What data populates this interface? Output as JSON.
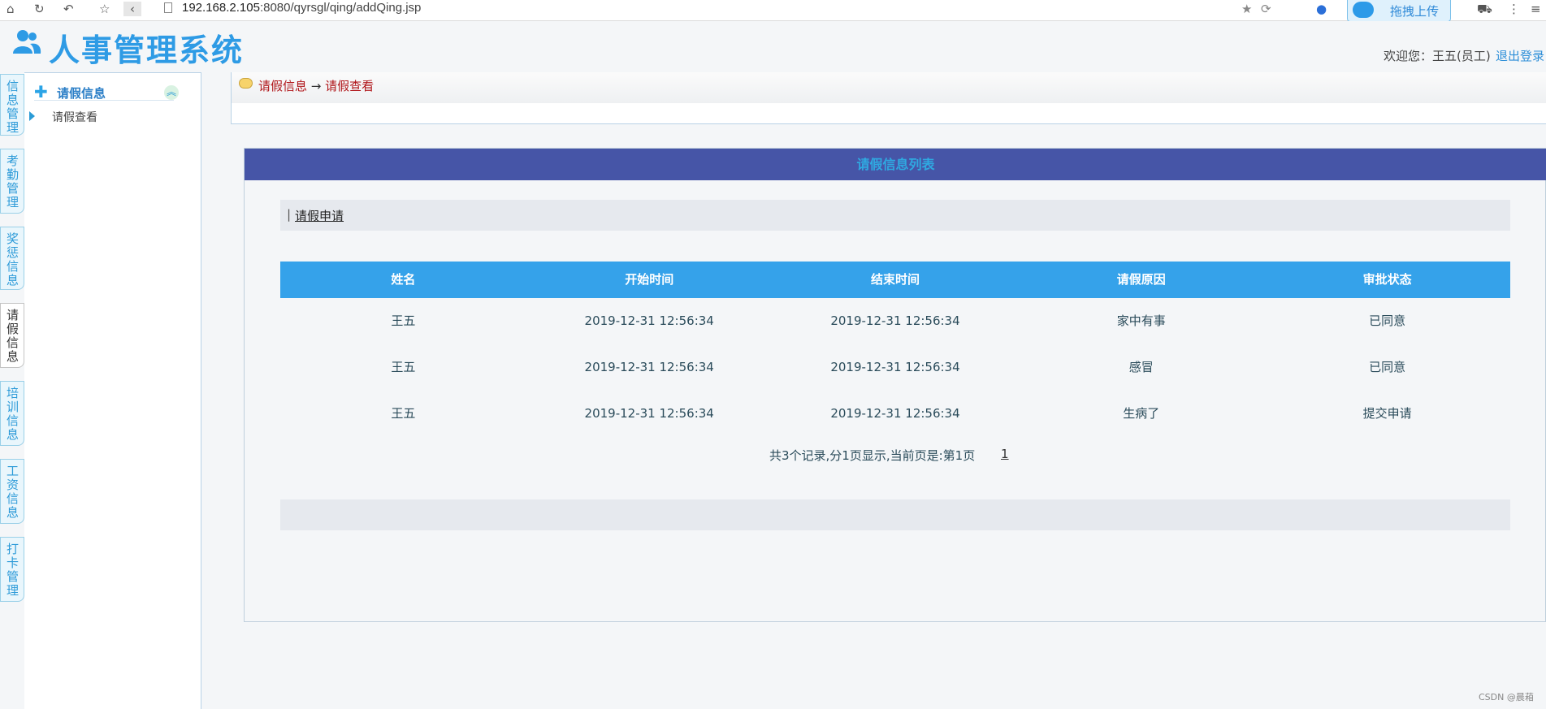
{
  "browser": {
    "url_host": "192.168.2.105",
    "url_rest": ":8080/qyrsgl/qing/addQing.jsp",
    "upload_label": "拖拽上传"
  },
  "header": {
    "app_title": "人事管理系统",
    "welcome": "欢迎您：王五(员工)",
    "logout": "退出登录"
  },
  "tabs": [
    {
      "label": "信息管理"
    },
    {
      "label": "考勤管理"
    },
    {
      "label": "奖惩信息"
    },
    {
      "label": "请假信息",
      "active": true
    },
    {
      "label": "培训信息"
    },
    {
      "label": "工资信息"
    },
    {
      "label": "打卡管理"
    }
  ],
  "sidebar": {
    "title": "请假信息",
    "items": [
      {
        "label": "请假查看"
      }
    ]
  },
  "breadcrumb": {
    "first": "请假信息",
    "separator": " → ",
    "second": "请假查看"
  },
  "panel": {
    "title": "请假信息列表",
    "toolbar_sep": "|",
    "toolbar_link": "请假申请"
  },
  "table": {
    "columns": [
      "姓名",
      "开始时间",
      "结束时间",
      "请假原因",
      "审批状态"
    ],
    "rows": [
      [
        "王五",
        "2019-12-31 12:56:34",
        "2019-12-31 12:56:34",
        "家中有事",
        "已同意"
      ],
      [
        "王五",
        "2019-12-31 12:56:34",
        "2019-12-31 12:56:34",
        "感冒",
        "已同意"
      ],
      [
        "王五",
        "2019-12-31 12:56:34",
        "2019-12-31 12:56:34",
        "生病了",
        "提交申请"
      ]
    ]
  },
  "pager": {
    "summary": "共3个记录,分1页显示,当前页是:第1页",
    "page_link": "1"
  },
  "watermark": "CSDN @晨葙"
}
